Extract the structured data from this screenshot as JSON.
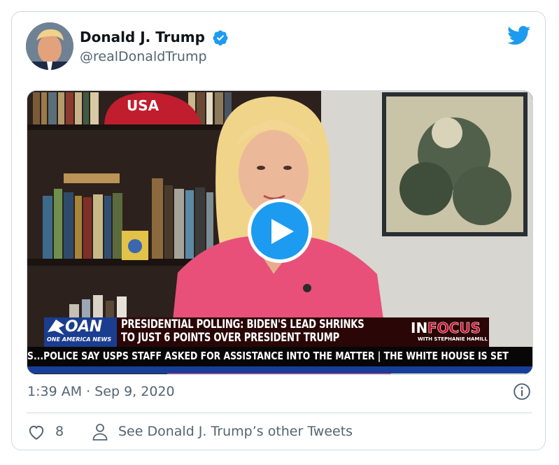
{
  "user": {
    "name": "Donald J. Trump",
    "handle": "@realDonaldTrump"
  },
  "icons": {
    "verified": "verified-badge-icon",
    "bird": "twitter-bird-icon",
    "play": "play-icon",
    "info": "info-icon",
    "like": "heart-icon",
    "person": "person-icon"
  },
  "colors": {
    "accent": "#1d9bf0",
    "secondary_text": "#536471",
    "border": "#cfd9de"
  },
  "video": {
    "hat_text": "USA",
    "network_logo": "OAN",
    "network_sub": "ONE AMERICA NEWS",
    "headline_line1": "PRESIDENTIAL POLLING: BIDEN'S LEAD SHRINKS",
    "headline_line2": "TO JUST 6 POINTS OVER PRESIDENT TRUMP",
    "show_in": "IN",
    "show_focus": "FOCUS",
    "show_sub": "WITH STEPHANIE HAMILL",
    "ticker": "S...POLICE SAY USPS STAFF ASKED FOR ASSISTANCE INTO THE MATTER  |  THE WHITE HOUSE IS SET"
  },
  "tweet": {
    "timestamp": "1:39 AM · Sep 9, 2020",
    "like_count": "8",
    "other_tweets_link": "See Donald J. Trump’s other Tweets"
  }
}
